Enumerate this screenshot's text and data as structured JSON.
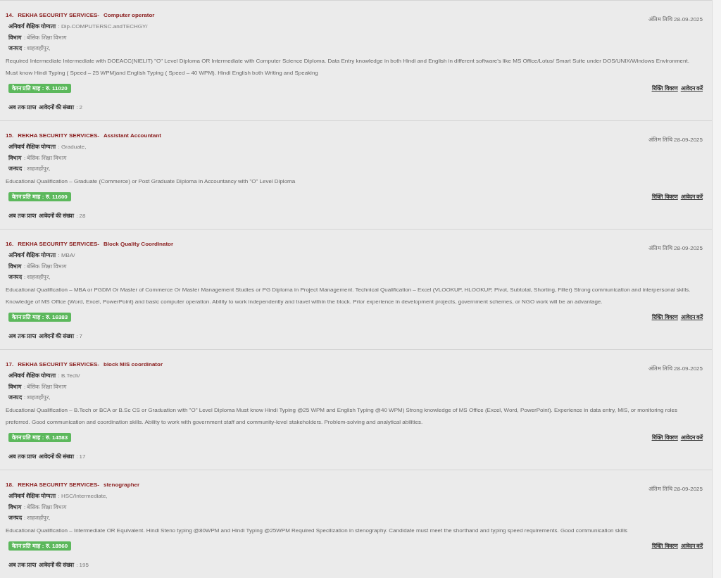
{
  "jobs": [
    {
      "number": "14.",
      "employer": "REKHA SECURITY SERVICES-",
      "post": "Computer operator",
      "last_date": "अंतिम तिथि 28-09-2025",
      "fields": [
        {
          "label": "अनिवार्य शैक्षिक योग्यता",
          "value": ": Dip-COMPUTERSC.andTECHGY/"
        },
        {
          "label": "विभाग",
          "value": ": बेसिक शिक्षा विभाग"
        },
        {
          "label": "जनपद",
          "value": ": शाहजहाँपुर,"
        }
      ],
      "description": "Required Intermediate Intermediate with DOEACC(NIELIT) \"O\" Level Diploma OR Intermediate with Computer Science Diploma. Data Entry knowledge in both Hindi and English in different software's like MS Office/Lotus/ Smart Suite under DOS/UNIX/Windows Environment. Must know Hindi Typing ( Speed – 25 WPM)and English Typing ( Speed – 40 WPM). Hindi English both Writing and Speaking",
      "salary": "वेतन प्रति माह : रु. 11020",
      "links": [
        "रिक्ति विवरण",
        "आवेदन करें"
      ],
      "applications": {
        "label": "अब तक प्राप्त आवेदनों की संख्या",
        "value": ": 2"
      }
    },
    {
      "number": "15.",
      "employer": "REKHA SECURITY SERVICES-",
      "post": "Assistant Accountant",
      "last_date": "अंतिम तिथि 28-09-2025",
      "fields": [
        {
          "label": "अनिवार्य शैक्षिक योग्यता",
          "value": ": Graduate,"
        },
        {
          "label": "विभाग",
          "value": ": बेसिक शिक्षा विभाग"
        },
        {
          "label": "जनपद",
          "value": ": शाहजहाँपुर,"
        }
      ],
      "description": "Educational Qualification – Graduate (Commerce) or Post Graduate Diploma in Accountancy with \"O\" Level Diploma",
      "salary": "वेतन प्रति माह : रु. 11600",
      "links": [
        "रिक्ति विवरण",
        "आवेदन करें"
      ],
      "applications": {
        "label": "अब तक प्राप्त आवेदनों की संख्या",
        "value": ": 28"
      }
    },
    {
      "number": "16.",
      "employer": "REKHA SECURITY SERVICES-",
      "post": "Block Quality Coordinator",
      "last_date": "अंतिम तिथि 28-09-2025",
      "fields": [
        {
          "label": "अनिवार्य शैक्षिक योग्यता",
          "value": ": MBA/"
        },
        {
          "label": "विभाग",
          "value": ": बेसिक शिक्षा विभाग"
        },
        {
          "label": "जनपद",
          "value": ": शाहजहाँपुर,"
        }
      ],
      "description": "Educational Qualification – MBA or PGDM Or Master of Commerce Or Master Management Studies or PG Diploma in Project Management. Technical Qualification – Excel (VLOOKUP, HLOOKUP, Pivot, Subtotal, Shorting, Filter) Strong communication and interpersonal skills. Knowledge of MS Office (Word, Excel, PowerPoint) and basic computer operation. Ability to work independently and travel within the block. Prior experience in development projects, government schemes, or NGO work will be an advantage.",
      "salary": "वेतन प्रति माह : रु. 16383",
      "links": [
        "रिक्ति विवरण",
        "आवेदन करें"
      ],
      "applications": {
        "label": "अब तक प्राप्त आवेदनों की संख्या",
        "value": ": 7"
      }
    },
    {
      "number": "17.",
      "employer": "REKHA SECURITY SERVICES-",
      "post": "block MIS coordinator",
      "last_date": "अंतिम तिथि 28-09-2025",
      "fields": [
        {
          "label": "अनिवार्य शैक्षिक योग्यता",
          "value": ": B.Tech/"
        },
        {
          "label": "विभाग",
          "value": ": बेसिक शिक्षा विभाग"
        },
        {
          "label": "जनपद",
          "value": ": शाहजहाँपुर,"
        }
      ],
      "description": "Educational Qualification – B.Tech or BCA or B.Sc CS or Graduation with \"O\" Level Diploma Must know Hindi Typing @25 WPM and English Typing @40 WPM) Strong knowledge of MS Office (Excel, Word, PowerPoint). Experience in data entry, MIS, or monitoring roles preferred. Good communication and coordination skills. Ability to work with government staff and community-level stakeholders. Problem-solving and analytical abilities.",
      "salary": "वेतन प्रति माह : रु. 14583",
      "links": [
        "रिक्ति विवरण",
        "आवेदन करें"
      ],
      "applications": {
        "label": "अब तक प्राप्त आवेदनों की संख्या",
        "value": ": 17"
      }
    },
    {
      "number": "18.",
      "employer": "REKHA SECURITY SERVICES-",
      "post": "stenographer",
      "last_date": "अंतिम तिथि 28-09-2025",
      "fields": [
        {
          "label": "अनिवार्य शैक्षिक योग्यता",
          "value": ": HSC/Intermediate,"
        },
        {
          "label": "विभाग",
          "value": ": बेसिक शिक्षा विभाग"
        },
        {
          "label": "जनपद",
          "value": ": शाहजहाँपुर,"
        }
      ],
      "description": "Educational Qualification – Intermediate OR Equivalent. Hindi Steno typing @80WPM and Hindi Typing @25WPM Required Specilization in stenography. Candidate must meet the shorthand and typing speed requirements. Good communication skills",
      "salary": "वेतन प्रति माह : रु. 18560",
      "links": [
        "रिक्ति विवरण",
        "आवेदन करें"
      ],
      "applications": {
        "label": "अब तक प्राप्त आवेदनों की संख्या",
        "value": ": 195"
      }
    }
  ]
}
